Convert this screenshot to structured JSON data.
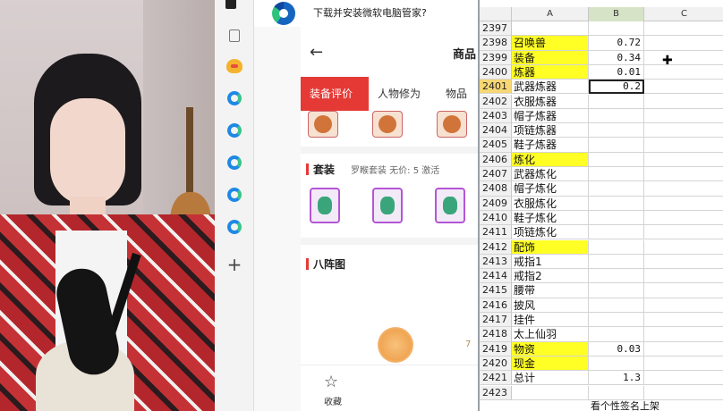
{
  "browser": {
    "download_prompt": "下载并安装微软电脑管家?",
    "app_title": "商品",
    "tabs": [
      "装备评价",
      "人物修为",
      "物品"
    ],
    "section_set": {
      "title": "套装",
      "subtitle": "罗睺套装  无价: 5  激活"
    },
    "section_formation": {
      "title": "八阵图"
    },
    "formation_num": "7",
    "bottom_nav": {
      "favorite_label": "收藏"
    }
  },
  "sheet": {
    "columns": [
      "A",
      "B",
      "C"
    ],
    "selected_column": "B",
    "watermark": "",
    "rows": [
      {
        "num": "2397",
        "a": "",
        "b": "",
        "hl": false
      },
      {
        "num": "2398",
        "a": "召唤兽",
        "b": "0.72",
        "hl": true
      },
      {
        "num": "2399",
        "a": "装备",
        "b": "0.34",
        "hl": true
      },
      {
        "num": "2400",
        "a": "炼器",
        "b": "0.01",
        "hl": true
      },
      {
        "num": "2401",
        "a": "武器炼器",
        "b": "0.2",
        "hl": false,
        "active": true
      },
      {
        "num": "2402",
        "a": "衣服炼器",
        "b": "",
        "hl": false
      },
      {
        "num": "2403",
        "a": "帽子炼器",
        "b": "",
        "hl": false
      },
      {
        "num": "2404",
        "a": "项链炼器",
        "b": "",
        "hl": false
      },
      {
        "num": "2405",
        "a": "鞋子炼器",
        "b": "",
        "hl": false
      },
      {
        "num": "2406",
        "a": "炼化",
        "b": "",
        "hl": true
      },
      {
        "num": "2407",
        "a": "武器炼化",
        "b": "",
        "hl": false
      },
      {
        "num": "2408",
        "a": "帽子炼化",
        "b": "",
        "hl": false
      },
      {
        "num": "2409",
        "a": "衣服炼化",
        "b": "",
        "hl": false
      },
      {
        "num": "2410",
        "a": "鞋子炼化",
        "b": "",
        "hl": false
      },
      {
        "num": "2411",
        "a": "项链炼化",
        "b": "",
        "hl": false
      },
      {
        "num": "2412",
        "a": "配饰",
        "b": "",
        "hl": true
      },
      {
        "num": "2413",
        "a": "戒指1",
        "b": "",
        "hl": false
      },
      {
        "num": "2414",
        "a": "戒指2",
        "b": "",
        "hl": false
      },
      {
        "num": "2415",
        "a": "腰带",
        "b": "",
        "hl": false
      },
      {
        "num": "2416",
        "a": "披风",
        "b": "",
        "hl": false
      },
      {
        "num": "2417",
        "a": "挂件",
        "b": "",
        "hl": false
      },
      {
        "num": "2418",
        "a": "太上仙羽",
        "b": "",
        "hl": false
      },
      {
        "num": "2419",
        "a": "物资",
        "b": "0.03",
        "hl": true
      },
      {
        "num": "2420",
        "a": "现金",
        "b": "",
        "hl": true
      },
      {
        "num": "2421",
        "a": "总计",
        "b": "1.3",
        "hl": false
      },
      {
        "num": "2423",
        "a": "",
        "b": "",
        "hl": false
      }
    ],
    "footer_note": "看个性签名上架"
  },
  "colors": {
    "highlight": "#ffff26",
    "accent_red": "#e53935",
    "edge_blue": "#1e88e5"
  }
}
